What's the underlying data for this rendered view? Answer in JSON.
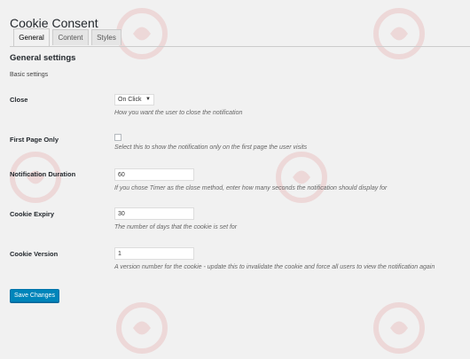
{
  "page": {
    "title": "Cookie Consent"
  },
  "tabs": [
    {
      "label": "General",
      "active": true
    },
    {
      "label": "Content",
      "active": false
    },
    {
      "label": "Styles",
      "active": false
    }
  ],
  "section": {
    "title": "General settings",
    "subtitle": "Basic settings"
  },
  "fields": {
    "close": {
      "label": "Close",
      "value": "On Click",
      "description": "How you want the user to close the notification"
    },
    "first_page_only": {
      "label": "First Page Only",
      "checked": false,
      "description": "Select this to show the notification only on the first page the user visits"
    },
    "notification_duration": {
      "label": "Notification Duration",
      "value": "60",
      "description": "If you chose Timer as the close method, enter how many seconds the notification should display for"
    },
    "cookie_expiry": {
      "label": "Cookie Expiry",
      "value": "30",
      "description": "The number of days that the cookie is set for"
    },
    "cookie_version": {
      "label": "Cookie Version",
      "value": "1",
      "description": "A version number for the cookie - update this to invalidate the cookie and force all users to view the notification again"
    }
  },
  "actions": {
    "save_label": "Save Changes"
  },
  "colors": {
    "primary_button": "#0085ba",
    "background": "#f1f1f1",
    "watermark": "#d32f2f"
  }
}
